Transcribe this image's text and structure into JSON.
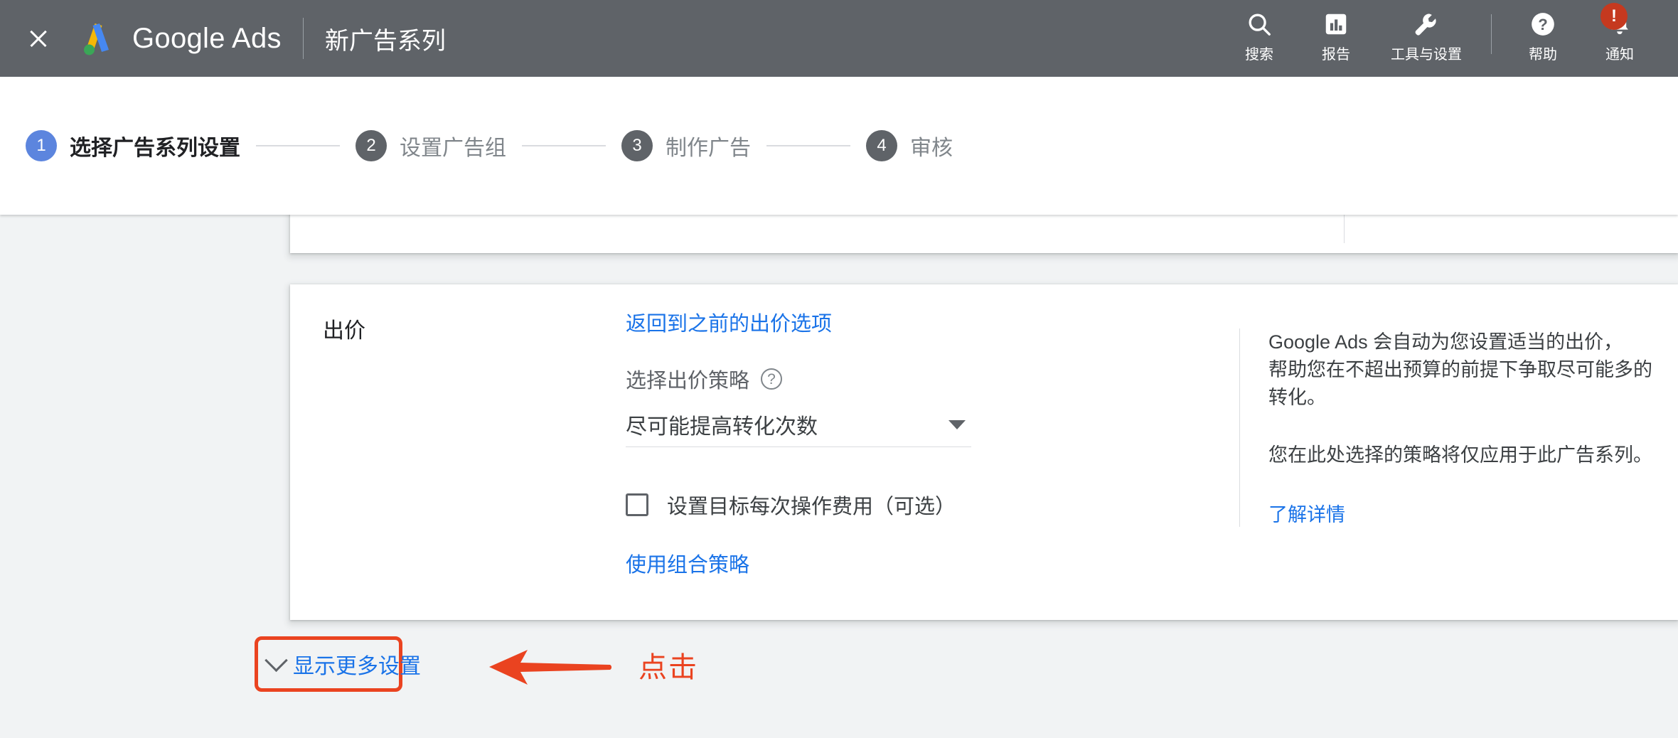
{
  "topbar": {
    "close_icon": "close-icon",
    "brand": "Google Ads",
    "page_title": "新广告系列",
    "nav": [
      {
        "icon": "search-icon",
        "label": "搜索"
      },
      {
        "icon": "reports-bar-chart-icon",
        "label": "报告"
      },
      {
        "icon": "wrench-tools-icon",
        "label": "工具与设置"
      },
      {
        "icon": "help-question-icon",
        "label": "帮助"
      },
      {
        "icon": "bell-notification-icon",
        "label": "通知",
        "badge": "!"
      }
    ],
    "background_color": "#5f6368"
  },
  "stepper": {
    "steps": [
      {
        "number": "1",
        "label": "选择广告系列设置",
        "active": true
      },
      {
        "number": "2",
        "label": "设置广告组",
        "active": false
      },
      {
        "number": "3",
        "label": "制作广告",
        "active": false
      },
      {
        "number": "4",
        "label": "审核",
        "active": false
      }
    ],
    "active_color": "#5c85de",
    "inactive_color": "#5f6368"
  },
  "bidding_card": {
    "section_label": "出价",
    "back_link": "返回到之前的出价选项",
    "strategy_sublabel": "选择出价策略",
    "help_icon": "help-question-circle-icon",
    "strategy_value": "尽可能提高转化次数",
    "caret_icon": "chevron-down-icon",
    "checkbox_label": "设置目标每次操作费用（可选）",
    "checkbox_checked": false,
    "portfolio_link": "使用组合策略",
    "info_paragraph_1": "Google Ads 会自动为您设置适当的出价，\n帮助您在不超出预算的前提下争取尽可能多的转化。",
    "info_paragraph_2": "您在此处选择的策略将仅应用于此广告系列。",
    "info_link": "了解详情"
  },
  "show_more": {
    "icon": "chevron-down-icon",
    "label": "显示更多设置",
    "highlight_color": "#ea4320"
  },
  "annotation": {
    "arrow_icon": "left-arrow-annotation-icon",
    "text": "点击",
    "color": "#ea4320"
  },
  "colors": {
    "link": "#1a73e8",
    "page_background": "#f1f3f4",
    "card_background": "#ffffff",
    "text_primary": "#202124",
    "text_secondary": "#5f6368"
  }
}
